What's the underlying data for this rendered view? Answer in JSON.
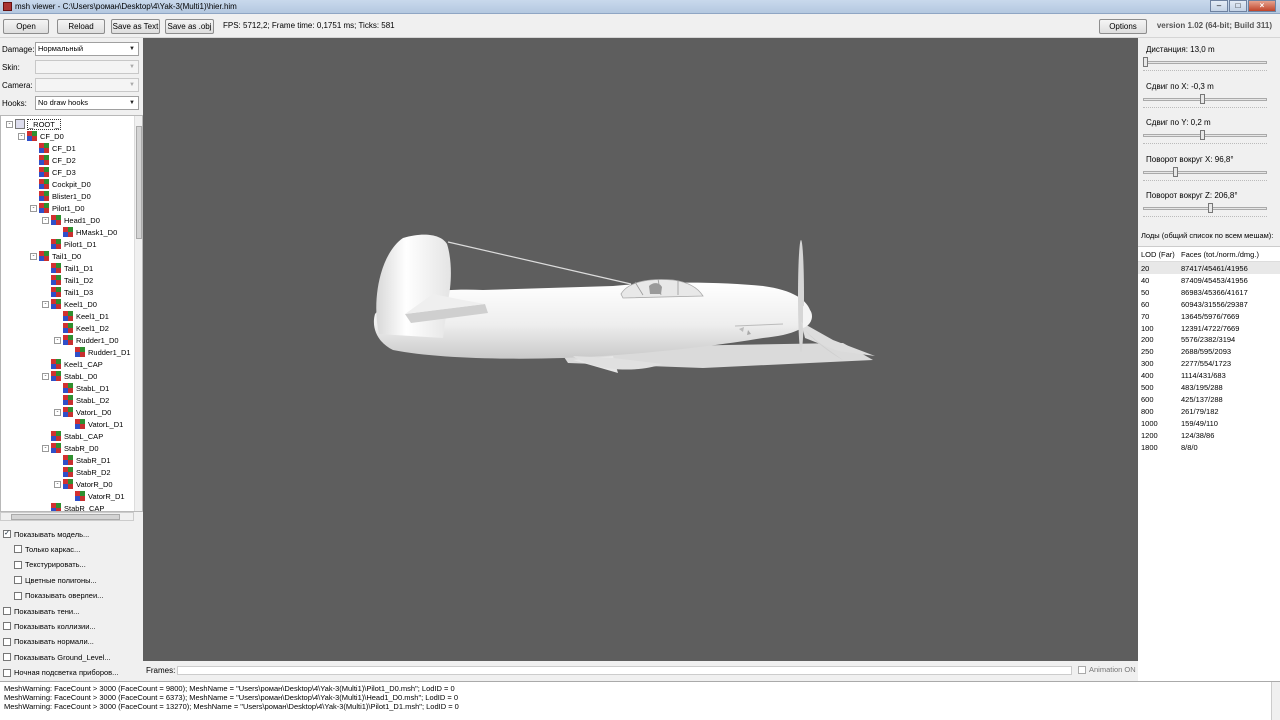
{
  "window": {
    "title": "msh viewer - C:\\Users\\роман\\Desktop\\4\\Yak-3(Multi1)\\hier.him"
  },
  "toolbar": {
    "open": "Open",
    "reload": "Reload",
    "save_text": "Save as Text",
    "save_obj": "Save as .obj",
    "fps": "FPS: 5712,2; Frame time: 0,1751 ms; Ticks: 581",
    "options": "Options",
    "version": "version 1.02 (64-bit; Build 311)"
  },
  "left": {
    "damage_label": "Damage:",
    "damage_value": "Нормальный",
    "skin_label": "Skin:",
    "skin_value": "",
    "camera_label": "Camera:",
    "camera_value": "",
    "hooks_label": "Hooks:",
    "hooks_value": "No draw hooks"
  },
  "tree": [
    {
      "label": "_ROOT_",
      "depth": 0,
      "expander": "-",
      "root": true,
      "selected": true
    },
    {
      "label": "CF_D0",
      "depth": 1,
      "expander": "-"
    },
    {
      "label": "CF_D1",
      "depth": 2,
      "expander": ""
    },
    {
      "label": "CF_D2",
      "depth": 2,
      "expander": ""
    },
    {
      "label": "CF_D3",
      "depth": 2,
      "expander": ""
    },
    {
      "label": "Cockpit_D0",
      "depth": 2,
      "expander": ""
    },
    {
      "label": "Blister1_D0",
      "depth": 2,
      "expander": ""
    },
    {
      "label": "Pilot1_D0",
      "depth": 2,
      "expander": "-"
    },
    {
      "label": "Head1_D0",
      "depth": 3,
      "expander": "-"
    },
    {
      "label": "HMask1_D0",
      "depth": 4,
      "expander": ""
    },
    {
      "label": "Pilot1_D1",
      "depth": 3,
      "expander": ""
    },
    {
      "label": "Tail1_D0",
      "depth": 2,
      "expander": "-"
    },
    {
      "label": "Tail1_D1",
      "depth": 3,
      "expander": ""
    },
    {
      "label": "Tail1_D2",
      "depth": 3,
      "expander": ""
    },
    {
      "label": "Tail1_D3",
      "depth": 3,
      "expander": ""
    },
    {
      "label": "Keel1_D0",
      "depth": 3,
      "expander": "-"
    },
    {
      "label": "Keel1_D1",
      "depth": 4,
      "expander": ""
    },
    {
      "label": "Keel1_D2",
      "depth": 4,
      "expander": ""
    },
    {
      "label": "Rudder1_D0",
      "depth": 4,
      "expander": "-"
    },
    {
      "label": "Rudder1_D1",
      "depth": 5,
      "expander": ""
    },
    {
      "label": "Keel1_CAP",
      "depth": 3,
      "expander": ""
    },
    {
      "label": "StabL_D0",
      "depth": 3,
      "expander": "-"
    },
    {
      "label": "StabL_D1",
      "depth": 4,
      "expander": ""
    },
    {
      "label": "StabL_D2",
      "depth": 4,
      "expander": ""
    },
    {
      "label": "VatorL_D0",
      "depth": 4,
      "expander": "-"
    },
    {
      "label": "VatorL_D1",
      "depth": 5,
      "expander": ""
    },
    {
      "label": "StabL_CAP",
      "depth": 3,
      "expander": ""
    },
    {
      "label": "StabR_D0",
      "depth": 3,
      "expander": "-"
    },
    {
      "label": "StabR_D1",
      "depth": 4,
      "expander": ""
    },
    {
      "label": "StabR_D2",
      "depth": 4,
      "expander": ""
    },
    {
      "label": "VatorR_D0",
      "depth": 4,
      "expander": "-"
    },
    {
      "label": "VatorR_D1",
      "depth": 5,
      "expander": ""
    },
    {
      "label": "StabR_CAP",
      "depth": 3,
      "expander": ""
    }
  ],
  "checks": [
    {
      "label": "Показывать модель...",
      "checked": true,
      "indent": 0
    },
    {
      "label": "Только каркас...",
      "checked": false,
      "indent": 1
    },
    {
      "label": "Текстурировать...",
      "checked": false,
      "indent": 1
    },
    {
      "label": "Цветные полигоны...",
      "checked": false,
      "indent": 1
    },
    {
      "label": "Показывать оверлеи...",
      "checked": false,
      "indent": 1
    },
    {
      "label": "Показывать тени...",
      "checked": false,
      "indent": 0
    },
    {
      "label": "Показывать коллизии...",
      "checked": false,
      "indent": 0
    },
    {
      "label": "Показывать нормали...",
      "checked": false,
      "indent": 0
    },
    {
      "label": "Показывать Ground_Level...",
      "checked": false,
      "indent": 0
    },
    {
      "label": "Ночная подсветка приборов...",
      "checked": false,
      "indent": 0
    }
  ],
  "frames": {
    "label": "Frames:",
    "animation": "Animation ON"
  },
  "right": {
    "sliders": [
      {
        "label": "Дистанция:  13,0 m",
        "value": 0.0
      },
      {
        "label": "Сдвиг по X:  -0,3 m",
        "value": 0.48
      },
      {
        "label": "Сдвиг по Y:  0,2 m",
        "value": 0.48
      },
      {
        "label": "Поворот вокруг X:  96,8°",
        "value": 0.25
      },
      {
        "label": "Поворот вокруг Z:  206,8°",
        "value": 0.55
      }
    ],
    "lods_title": "Лоды (общий список по всем мешам):",
    "lod_col1": "LOD (Far)",
    "lod_col2": "Faces (tot./norm./dmg.)",
    "lods": [
      {
        "lod": "20",
        "faces": "87417/45461/41956"
      },
      {
        "lod": "40",
        "faces": "87409/45453/41956"
      },
      {
        "lod": "50",
        "faces": "86983/45366/41617"
      },
      {
        "lod": "60",
        "faces": "60943/31556/29387"
      },
      {
        "lod": "70",
        "faces": "13645/5976/7669"
      },
      {
        "lod": "100",
        "faces": "12391/4722/7669"
      },
      {
        "lod": "200",
        "faces": "5576/2382/3194"
      },
      {
        "lod": "250",
        "faces": "2688/595/2093"
      },
      {
        "lod": "300",
        "faces": "2277/554/1723"
      },
      {
        "lod": "400",
        "faces": "1114/431/683"
      },
      {
        "lod": "500",
        "faces": "483/195/288"
      },
      {
        "lod": "600",
        "faces": "425/137/288"
      },
      {
        "lod": "800",
        "faces": "261/79/182"
      },
      {
        "lod": "1000",
        "faces": "159/49/110"
      },
      {
        "lod": "1200",
        "faces": "124/38/86"
      },
      {
        "lod": "1800",
        "faces": "8/8/0"
      }
    ]
  },
  "log": [
    "MeshWarning: FaceCount > 3000 (FaceCount = 9800); MeshName = \"Users\\роман\\Desktop\\4\\Yak-3(Multi1)\\Pilot1_D0.msh\"; LodID = 0",
    "MeshWarning: FaceCount > 3000 (FaceCount = 6373); MeshName = \"Users\\роман\\Desktop\\4\\Yak-3(Multi1)\\Head1_D0.msh\"; LodID = 0",
    "MeshWarning: FaceCount > 3000 (FaceCount = 13270); MeshName = \"Users\\роман\\Desktop\\4\\Yak-3(Multi1)\\Pilot1_D1.msh\"; LodID = 0"
  ]
}
